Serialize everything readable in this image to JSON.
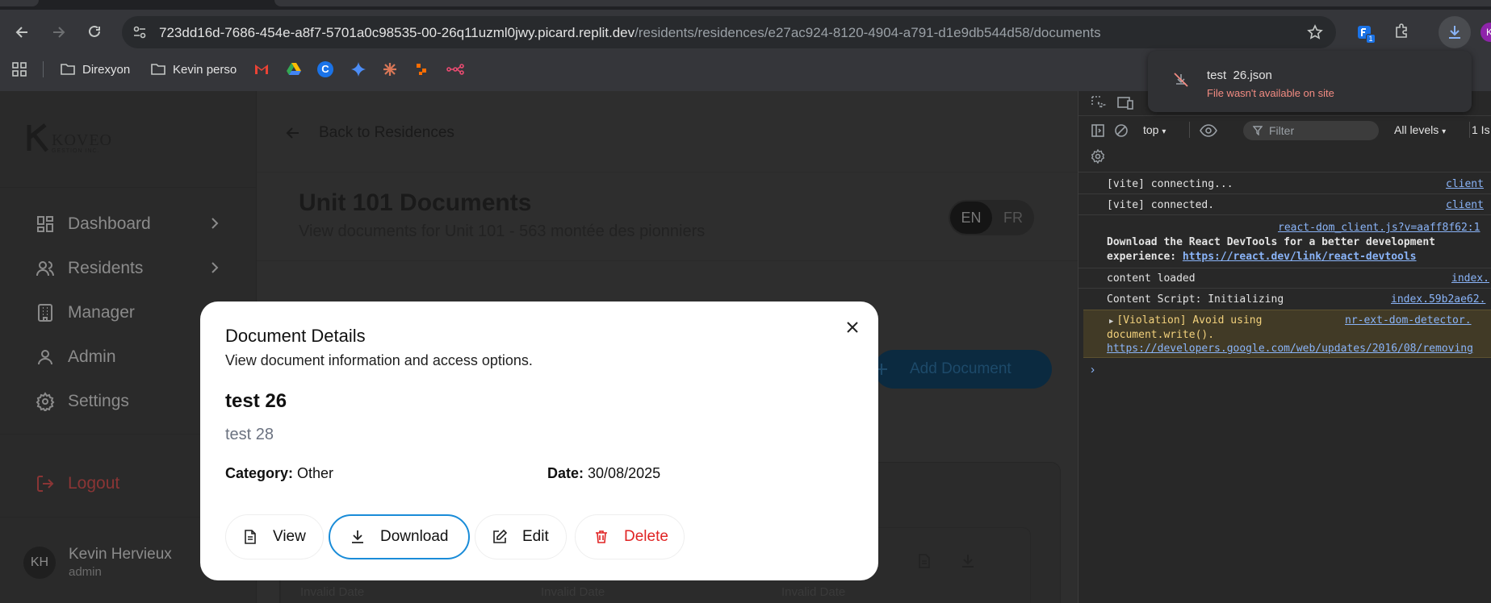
{
  "browser": {
    "url_host": "723dd16d-7686-454e-a8f7-5701a0c98535-00-26q11uzml0jwy.picard.replit.dev",
    "url_path": "/residents/residences/e27ac924-8120-4904-a791-d1e9db544d58/documents",
    "bookmarks": [
      {
        "label": "Direxyon",
        "icon": "folder-icon"
      },
      {
        "label": "Kevin perso",
        "icon": "folder-icon"
      }
    ],
    "extension_badge": "1",
    "profile_initial": "K"
  },
  "download": {
    "filename": "test  26.json",
    "status": "File wasn't available on site"
  },
  "sidebar": {
    "logo_text": "KOVEO",
    "logo_subtext": "GESTION INC.",
    "items": [
      {
        "label": "Dashboard",
        "icon": "grid-icon",
        "chevron": true
      },
      {
        "label": "Residents",
        "icon": "users-icon",
        "chevron": true
      },
      {
        "label": "Manager",
        "icon": "building-icon",
        "chevron": false
      },
      {
        "label": "Admin",
        "icon": "user-icon",
        "chevron": false
      },
      {
        "label": "Settings",
        "icon": "gear-icon",
        "chevron": false
      }
    ],
    "logout": "Logout",
    "user": {
      "initials": "KH",
      "name": "Kevin Hervieux",
      "role": "admin"
    }
  },
  "main": {
    "back_label": "Back to Residences",
    "title": "Unit 101 Documents",
    "subtitle": "View documents for Unit 101 - 563 montée des pionniers",
    "lang_en": "EN",
    "lang_fr": "FR",
    "add_document": "Add Document",
    "card_dates": [
      "Invalid Date",
      "Invalid Date",
      "Invalid Date"
    ]
  },
  "modal": {
    "title": "Document Details",
    "description": "View document information and access options.",
    "doc_name": "test 26",
    "doc_desc": "test 28",
    "category_label": "Category:",
    "category_value": "Other",
    "date_label": "Date:",
    "date_value": "30/08/2025",
    "buttons": {
      "view": "View",
      "download": "Download",
      "edit": "Edit",
      "delete": "Delete"
    }
  },
  "devtools": {
    "context": "top",
    "filter_placeholder": "Filter",
    "levels": "All levels",
    "issues": "1 Is",
    "logs": [
      {
        "text": "[vite] connecting...",
        "source": "client"
      },
      {
        "text": "[vite] connected.",
        "source": "client"
      },
      {
        "source": "react-dom_client.js?v=aaff8f62:1",
        "text1": "Download the React DevTools for a better development",
        "text2": "experience: ",
        "link": "https://react.dev/link/react-devtools"
      },
      {
        "text": "content loaded",
        "source": "index."
      },
      {
        "text": "Content Script: Initializing",
        "source": "index.59b2ae62."
      },
      {
        "text1": "[Violation] Avoid using",
        "text2": "document.write().",
        "link": "https://developers.google.com/web/updates/2016/08/removing",
        "source": "nr-ext-dom-detector."
      }
    ]
  },
  "colors": {
    "accent": "#1a8cd8",
    "danger": "#e02424",
    "warning_bg": "#413a26"
  }
}
